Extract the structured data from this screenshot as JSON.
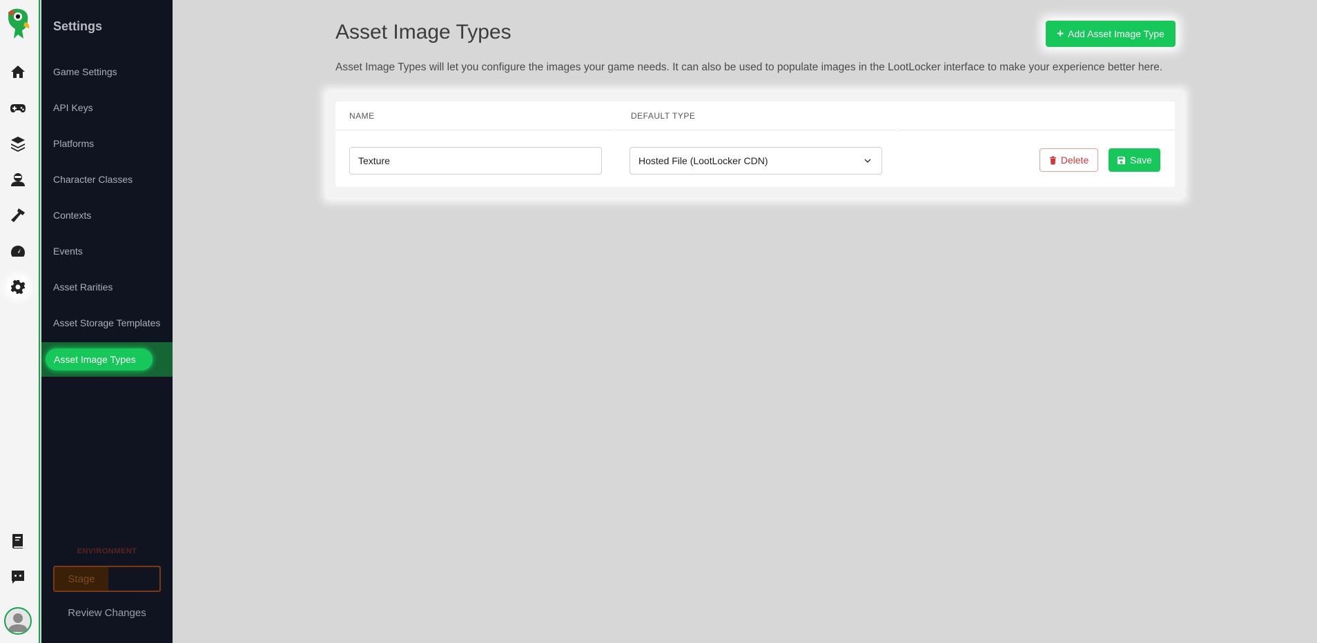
{
  "rail": {
    "icons": [
      "logo-parrot-icon",
      "home-icon",
      "gamepad-icon",
      "layers-icon",
      "players-icon",
      "hammer-icon",
      "gauge-icon",
      "gear-icon",
      "book-icon",
      "discord-icon",
      "user-avatar-icon"
    ]
  },
  "sidebar": {
    "title": "Settings",
    "items": [
      {
        "label": "Game Settings"
      },
      {
        "label": "API Keys"
      },
      {
        "label": "Platforms"
      },
      {
        "label": "Character Classes"
      },
      {
        "label": "Contexts"
      },
      {
        "label": "Events"
      },
      {
        "label": "Asset Rarities"
      },
      {
        "label": "Asset Storage Templates"
      },
      {
        "label": "Asset Image Types"
      }
    ],
    "environment_label": "ENVIRONMENT",
    "environment_value": "Stage",
    "review_label": "Review Changes"
  },
  "main": {
    "title": "Asset Image Types",
    "description": "Asset Image Types will let you configure the images your game needs. It can also be used to populate images in the LootLocker interface to make your experience better here.",
    "add_button": "Add Asset Image Type",
    "table": {
      "headers": [
        "NAME",
        "DEFAULT TYPE"
      ],
      "row": {
        "name": "Texture",
        "default_type": "Hosted File (LootLocker CDN)",
        "delete_label": "Delete",
        "save_label": "Save"
      }
    }
  },
  "colors": {
    "accent": "#16c75a",
    "sidebar_bg": "#0f1420",
    "delete": "#d0383a"
  }
}
